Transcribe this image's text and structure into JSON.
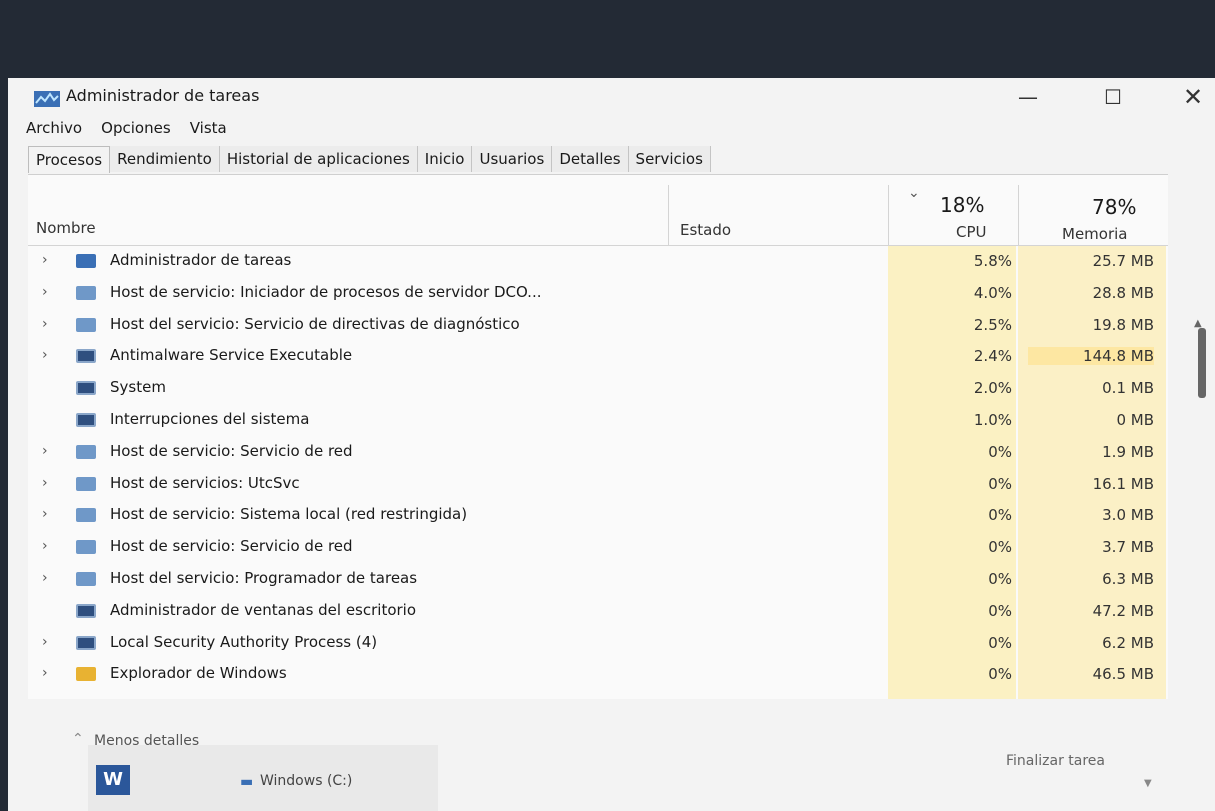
{
  "window": {
    "title": "Administrador de tareas",
    "controls": {
      "minimize": "—",
      "maximize": "☐",
      "close": "✕"
    }
  },
  "menu": [
    "Archivo",
    "Opciones",
    "Vista"
  ],
  "tabs": [
    "Procesos",
    "Rendimiento",
    "Historial de aplicaciones",
    "Inicio",
    "Usuarios",
    "Detalles",
    "Servicios"
  ],
  "active_tab": "Procesos",
  "columns": {
    "name": "Nombre",
    "state": "Estado",
    "cpu_total": "18%",
    "cpu": "CPU",
    "mem_total": "78%",
    "mem": "Memoria"
  },
  "processes": [
    {
      "name": "Administrador de tareas",
      "cpu": "5.8%",
      "mem": "25.7 MB",
      "expandable": true,
      "icon": "task-manager-icon"
    },
    {
      "name": "Host de servicio: Iniciador de procesos de servidor DCO...",
      "cpu": "4.0%",
      "mem": "28.8 MB",
      "expandable": true,
      "icon": "gear-icon"
    },
    {
      "name": "Host del servicio: Servicio de directivas de diagnóstico",
      "cpu": "2.5%",
      "mem": "19.8 MB",
      "expandable": true,
      "icon": "gear-icon"
    },
    {
      "name": "Antimalware Service Executable",
      "cpu": "2.4%",
      "mem": "144.8 MB",
      "expandable": true,
      "icon": "app-window-icon"
    },
    {
      "name": "System",
      "cpu": "2.0%",
      "mem": "0.1 MB",
      "expandable": false,
      "icon": "app-window-icon"
    },
    {
      "name": "Interrupciones del sistema",
      "cpu": "1.0%",
      "mem": "0 MB",
      "expandable": false,
      "icon": "app-window-icon"
    },
    {
      "name": "Host de servicio: Servicio de red",
      "cpu": "0%",
      "mem": "1.9 MB",
      "expandable": true,
      "icon": "gear-icon"
    },
    {
      "name": "Host de servicios: UtcSvc",
      "cpu": "0%",
      "mem": "16.1 MB",
      "expandable": true,
      "icon": "gear-icon"
    },
    {
      "name": "Host de servicio: Sistema local (red restringida)",
      "cpu": "0%",
      "mem": "3.0 MB",
      "expandable": true,
      "icon": "gear-icon"
    },
    {
      "name": "Host de servicio: Servicio de red",
      "cpu": "0%",
      "mem": "3.7 MB",
      "expandable": true,
      "icon": "gear-icon"
    },
    {
      "name": "Host del servicio: Programador de tareas",
      "cpu": "0%",
      "mem": "6.3 MB",
      "expandable": true,
      "icon": "gear-icon"
    },
    {
      "name": "Administrador de ventanas del escritorio",
      "cpu": "0%",
      "mem": "47.2 MB",
      "expandable": false,
      "icon": "app-window-icon"
    },
    {
      "name": "Local Security Authority Process (4)",
      "cpu": "0%",
      "mem": "6.2 MB",
      "expandable": true,
      "icon": "app-window-icon"
    },
    {
      "name": "Explorador de Windows",
      "cpu": "0%",
      "mem": "46.5 MB",
      "expandable": true,
      "icon": "folder-icon"
    }
  ],
  "footer": {
    "fewer_details": "Menos detalles",
    "end_task": "Finalizar tarea"
  },
  "taskbar": {
    "word_label": "W",
    "drive": "Windows (C:)"
  },
  "colors": {
    "cpu_heat": "#fbf1c3",
    "mem_heat": "#fbf0c6",
    "mem_hot": "#fde7a2"
  }
}
